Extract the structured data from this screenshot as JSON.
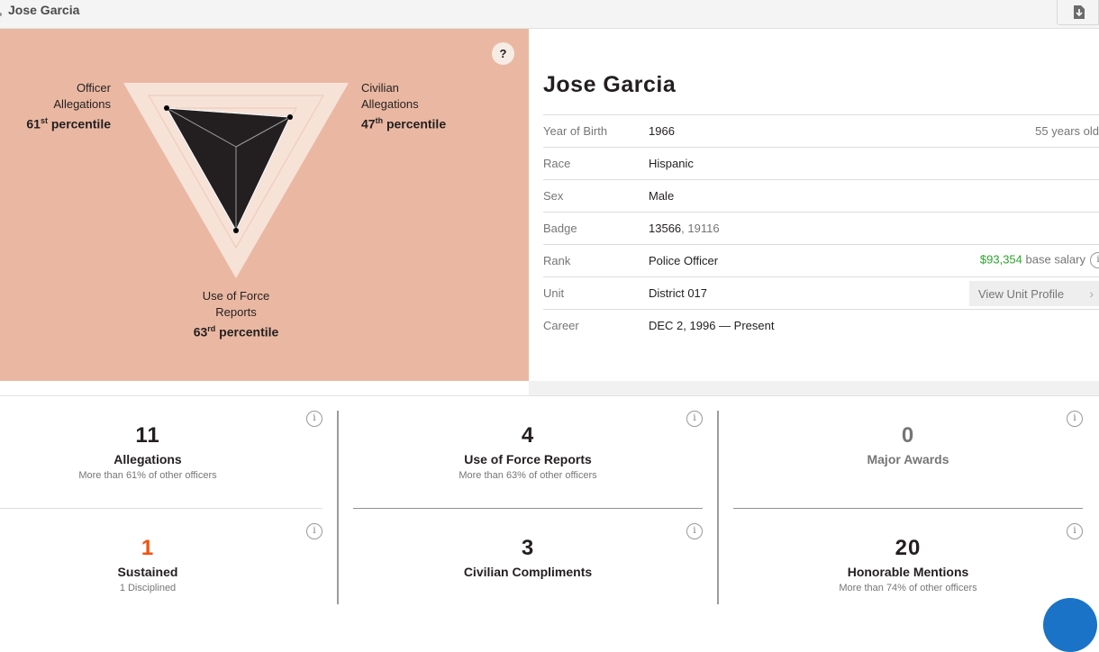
{
  "header": {
    "title": "Jose Garcia",
    "download_icon": "download-icon"
  },
  "radar": {
    "help_label": "?",
    "axes": [
      {
        "line1": "Officer",
        "line2": "Allegations",
        "value": 61,
        "suffix": "st",
        "pct_label": "percentile"
      },
      {
        "line1": "Civilian",
        "line2": "Allegations",
        "value": 47,
        "suffix": "th",
        "pct_label": "percentile"
      },
      {
        "line1": "Use of Force",
        "line2": "Reports",
        "value": 63,
        "suffix": "rd",
        "pct_label": "percentile"
      }
    ],
    "colors": {
      "background": "#eab8a2",
      "triangle": "#f7e2d8",
      "shape": "#231f20"
    }
  },
  "officer": {
    "name": "Jose Garcia",
    "rows": {
      "birth": {
        "label": "Year of Birth",
        "value": "1966",
        "extra": "55 years old"
      },
      "race": {
        "label": "Race",
        "value": "Hispanic"
      },
      "sex": {
        "label": "Sex",
        "value": "Male"
      },
      "badge": {
        "label": "Badge",
        "current": "13566",
        "sep": ",",
        "previous": "19116"
      },
      "rank": {
        "label": "Rank",
        "value": "Police Officer",
        "salary": "$93,354",
        "salary_label": "base salary",
        "info": "i"
      },
      "unit": {
        "label": "Unit",
        "value": "District 017",
        "button": "View Unit Profile",
        "chevron": "›"
      },
      "career": {
        "label": "Career",
        "value": "DEC 2, 1996 — Present"
      }
    }
  },
  "metrics": {
    "info": "i",
    "allegations": {
      "value": "11",
      "name": "Allegations",
      "desc": "More than 61% of other officers"
    },
    "force": {
      "value": "4",
      "name": "Use of Force Reports",
      "desc": "More than 63% of other officers"
    },
    "awards": {
      "value": "0",
      "name": "Major Awards"
    },
    "sustained": {
      "value": "1",
      "name": "Sustained",
      "desc": "1 Disciplined"
    },
    "compliments": {
      "value": "3",
      "name": "Civilian Compliments"
    },
    "mentions": {
      "value": "20",
      "name": "Honorable Mentions",
      "desc": "More than 74% of other officers"
    },
    "colors": {
      "sustained": "#f5500c"
    }
  }
}
